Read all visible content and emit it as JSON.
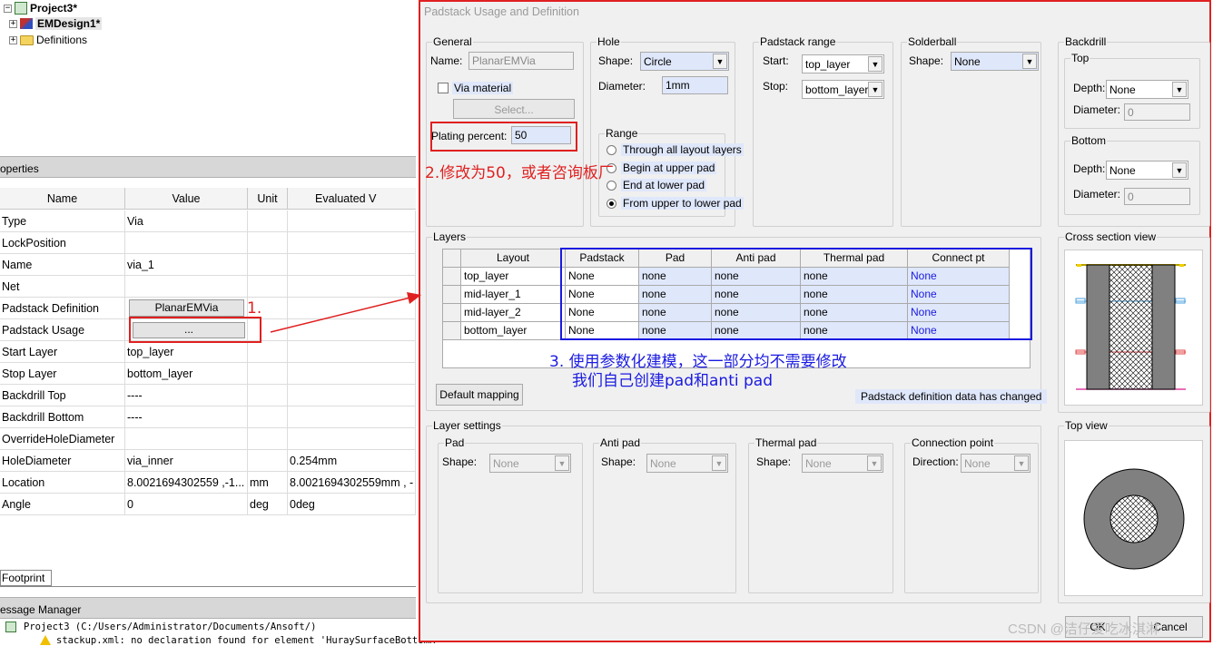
{
  "tree": {
    "project": "Project3*",
    "design": "EMDesign1*",
    "definitions": "Definitions"
  },
  "properties": {
    "title": "operties",
    "columns": [
      "Name",
      "Value",
      "Unit",
      "Evaluated V"
    ],
    "rows": [
      {
        "name": "Type",
        "value": "Via",
        "unit": "",
        "evaluated": ""
      },
      {
        "name": "LockPosition",
        "value": "",
        "unit": "",
        "evaluated": ""
      },
      {
        "name": "Name",
        "value": "via_1",
        "unit": "",
        "evaluated": ""
      },
      {
        "name": "Net",
        "value": "",
        "unit": "",
        "evaluated": ""
      },
      {
        "name": "Padstack Definition",
        "value": "PlanarEMVia",
        "unit": "",
        "evaluated": ""
      },
      {
        "name": "Padstack Usage",
        "value": "...",
        "unit": "",
        "evaluated": ""
      },
      {
        "name": "Start Layer",
        "value": "top_layer",
        "unit": "",
        "evaluated": ""
      },
      {
        "name": "Stop Layer",
        "value": "bottom_layer",
        "unit": "",
        "evaluated": ""
      },
      {
        "name": "Backdrill Top",
        "value": "----",
        "unit": "",
        "evaluated": ""
      },
      {
        "name": "Backdrill Bottom",
        "value": "----",
        "unit": "",
        "evaluated": ""
      },
      {
        "name": "OverrideHoleDiameter",
        "value": "",
        "unit": "",
        "evaluated": ""
      },
      {
        "name": "HoleDiameter",
        "value": "via_inner",
        "unit": "",
        "evaluated": "0.254mm"
      },
      {
        "name": "Location",
        "value": "8.0021694302559 ,-1...",
        "unit": "mm",
        "evaluated": "8.0021694302559mm , -"
      },
      {
        "name": "Angle",
        "value": "0",
        "unit": "deg",
        "evaluated": "0deg"
      }
    ],
    "lock_checked": false,
    "override_checked": true,
    "footprint_tab": "Footprint"
  },
  "messages": {
    "title": "essage Manager",
    "line1": "Project3 (C:/Users/Administrator/Documents/Ansoft/)",
    "line2": "stackup.xml: no declaration found for element 'HuraySurfaceBottomR"
  },
  "dialog": {
    "title": "Padstack Usage and Definition",
    "general": {
      "legend": "General",
      "name_label": "Name:",
      "name_value": "PlanarEMVia",
      "via_material_label": "Via material",
      "select_button": "Select...",
      "plating_label": "Plating percent:",
      "plating_value": "50"
    },
    "hole": {
      "legend": "Hole",
      "shape_label": "Shape:",
      "shape_value": "Circle",
      "diameter_label": "Diameter:",
      "diameter_value": "1mm",
      "range_legend": "Range",
      "range_options": [
        "Through all layout layers",
        "Begin at upper pad",
        "End at lower pad",
        "From upper to lower pad"
      ],
      "range_selected": "From upper to lower pad"
    },
    "padstack_range": {
      "legend": "Padstack range",
      "start_label": "Start:",
      "start_value": "top_layer",
      "stop_label": "Stop:",
      "stop_value": "bottom_layer"
    },
    "solderball": {
      "legend": "Solderball",
      "shape_label": "Shape:",
      "shape_value": "None"
    },
    "backdrill": {
      "legend": "Backdrill",
      "top_legend": "Top",
      "bottom_legend": "Bottom",
      "depth_label": "Depth:",
      "depth_value": "None",
      "diameter_label": "Diameter:",
      "diameter_value": "0"
    },
    "layers": {
      "legend": "Layers",
      "columns": [
        "Layout",
        "Padstack",
        "Pad",
        "Anti pad",
        "Thermal pad",
        "Connect pt"
      ],
      "rows": [
        [
          "top_layer",
          "None",
          "none",
          "none",
          "none",
          "None"
        ],
        [
          "mid-layer_1",
          "None",
          "none",
          "none",
          "none",
          "None"
        ],
        [
          "mid-layer_2",
          "None",
          "none",
          "none",
          "none",
          "None"
        ],
        [
          "bottom_layer",
          "None",
          "none",
          "none",
          "none",
          "None"
        ]
      ],
      "default_mapping_button": "Default mapping",
      "status": "Padstack definition data has changed"
    },
    "cross_section_legend": "Cross section view",
    "top_view_legend": "Top view",
    "layer_settings": {
      "legend": "Layer settings",
      "pad_legend": "Pad",
      "antipad_legend": "Anti pad",
      "thermal_legend": "Thermal pad",
      "connection_legend": "Connection point",
      "shape_label": "Shape:",
      "direction_label": "Direction:",
      "none_value": "None"
    },
    "ok_button": "OK",
    "cancel_button": "Cancel"
  },
  "annotations": {
    "step1": "1.",
    "step2": "2.修改为50，或者咨询板厂",
    "step3_line1": "3. 使用参数化建模，这一部分均不需要修改",
    "step3_line2": "我们自己创建pad和anti pad",
    "watermark": "CSDN @洁仔爱吃冰淇淋"
  }
}
